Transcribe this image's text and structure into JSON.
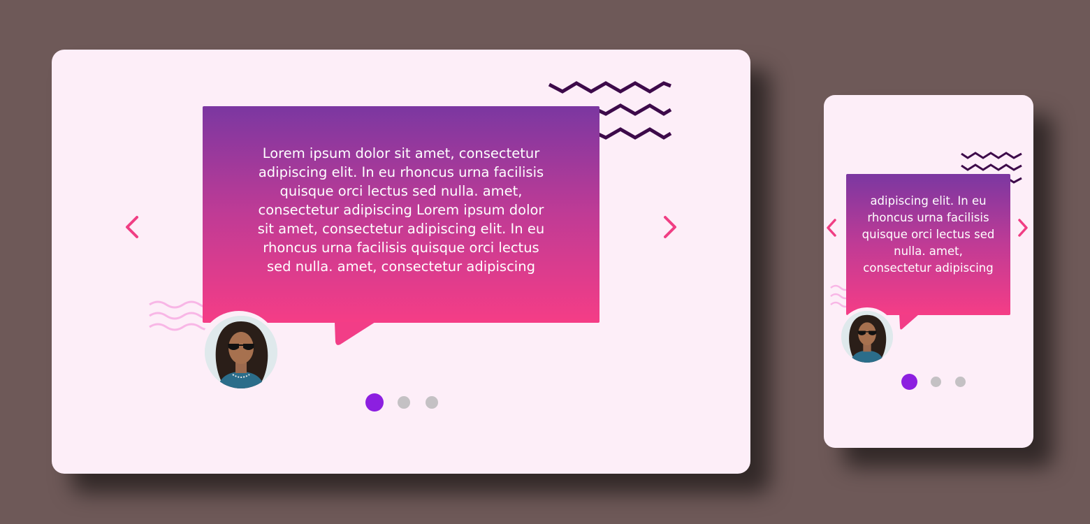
{
  "colors": {
    "background": "#6e5958",
    "card": "#fdeef8",
    "bubble_top": "#7b37a1",
    "bubble_bottom": "#f53d86",
    "arrow": "#f03e84",
    "dot_active": "#8c1fe0",
    "dot_inactive": "#c4c1c4",
    "zigzag": "#3d0a4a",
    "wave": "#f8b6e6"
  },
  "desktop": {
    "testimonial_text": "Lorem ipsum dolor sit amet, consectetur adipiscing elit. In eu rhoncus urna facilisis quisque orci lectus sed nulla. amet, consectetur adipiscing Lorem ipsum dolor sit amet, consectetur adipiscing elit. In eu rhoncus urna facilisis quisque orci lectus sed nulla. amet, consectetur adipiscing",
    "dots": [
      "active",
      "inactive",
      "inactive"
    ]
  },
  "mobile": {
    "testimonial_text": "adipiscing elit. In eu rhoncus urna facilisis quisque orci lectus sed nulla. amet, consectetur adipiscing",
    "dots": [
      "active",
      "inactive",
      "inactive"
    ]
  },
  "icons": {
    "prev": "chevron-left-icon",
    "next": "chevron-right-icon",
    "avatar": "person-avatar"
  }
}
